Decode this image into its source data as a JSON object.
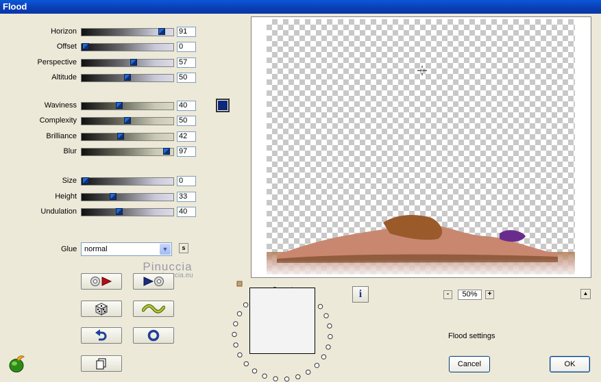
{
  "window": {
    "title": "Flood"
  },
  "sliders": [
    {
      "label": "Horizon",
      "value": "91",
      "pos": 0.91,
      "style": "gray"
    },
    {
      "label": "Offset",
      "value": "0",
      "pos": 0.0,
      "style": "gray"
    },
    {
      "label": "Perspective",
      "value": "57",
      "pos": 0.57,
      "style": "gray"
    },
    {
      "label": "Altitude",
      "value": "50",
      "pos": 0.5,
      "style": "gray"
    },
    {
      "label": "Waviness",
      "value": "40",
      "pos": 0.4,
      "style": "gold"
    },
    {
      "label": "Complexity",
      "value": "50",
      "pos": 0.5,
      "style": "gold"
    },
    {
      "label": "Brilliance",
      "value": "42",
      "pos": 0.42,
      "style": "gold"
    },
    {
      "label": "Blur",
      "value": "97",
      "pos": 0.97,
      "style": "gold"
    },
    {
      "label": "Size",
      "value": "0",
      "pos": 0.0,
      "style": "gray"
    },
    {
      "label": "Height",
      "value": "33",
      "pos": 0.33,
      "style": "gray"
    },
    {
      "label": "Undulation",
      "value": "40",
      "pos": 0.4,
      "style": "gray"
    }
  ],
  "color_swatch": "#0c2878",
  "glue": {
    "label": "Glue",
    "value": "normal",
    "s_label": "s"
  },
  "watermark": {
    "line1": "Pinuccia",
    "line2": "www.pinuccia.eu"
  },
  "zoom": {
    "minus": "-",
    "value": "50%",
    "plus": "+"
  },
  "status": {
    "settings": "Flood settings"
  },
  "buttons": {
    "cancel": "Cancel",
    "ok": "OK",
    "info": "i",
    "up": "▲"
  },
  "icons": [
    "play-filter-icon",
    "play-reset-icon",
    "dice-random-icon",
    "wave-icon",
    "undo-icon",
    "circle-reset-icon",
    "copy-icon",
    "crosshair-icon",
    "flaming-pear-logo-icon"
  ]
}
